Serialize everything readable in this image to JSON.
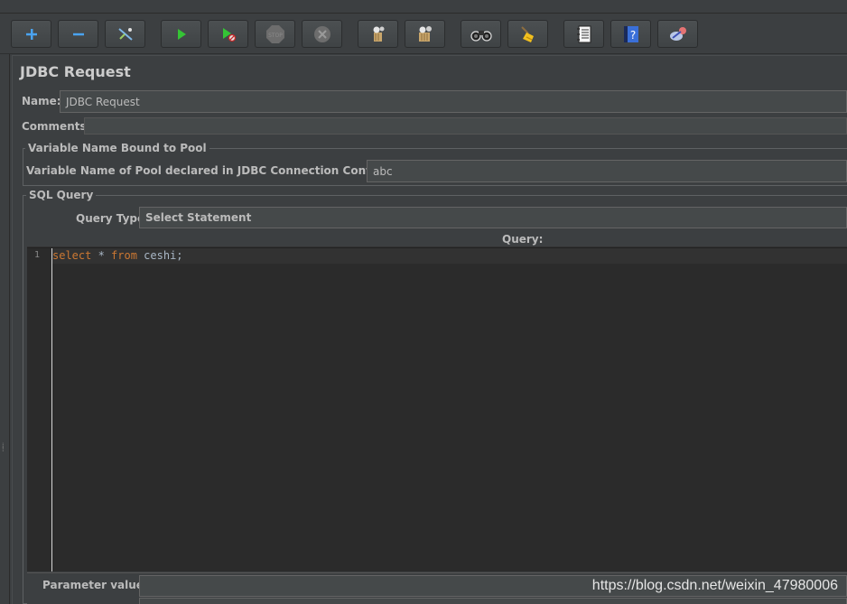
{
  "toolbar": {
    "buttons": [
      {
        "icon": "plus-icon"
      },
      {
        "icon": "minus-icon"
      },
      {
        "icon": "toggle-wand-icon"
      },
      {
        "icon": "start-icon"
      },
      {
        "icon": "start-no-pause-icon"
      },
      {
        "icon": "stop-icon"
      },
      {
        "icon": "shutdown-icon"
      },
      {
        "icon": "clear-icon"
      },
      {
        "icon": "clear-all-icon"
      },
      {
        "icon": "search-binoculars-icon"
      },
      {
        "icon": "reset-search-broom-icon"
      },
      {
        "icon": "function-helper-icon"
      },
      {
        "icon": "help-icon"
      },
      {
        "icon": "remote-start-icon"
      }
    ]
  },
  "panel": {
    "title": "JDBC Request",
    "name_label": "Name:",
    "name_value": "JDBC Request",
    "comments_label": "Comments:",
    "comments_value": ""
  },
  "pool_group": {
    "title": "Variable Name Bound to Pool",
    "pool_label": "Variable Name of Pool declared in JDBC Connection Configuration:",
    "pool_value": "abc"
  },
  "sql_group": {
    "title": "SQL Query",
    "query_type_label": "Query Type:",
    "query_type_value": "Select Statement",
    "query_label": "Query:",
    "line_number": "1",
    "code": {
      "kw1": "select",
      "mid": " * ",
      "kw2": "from",
      "rest": " ceshi;"
    },
    "param_values_label": "Parameter values:",
    "param_values_value": ""
  },
  "watermark": "https://blog.csdn.net/weixin_47980006",
  "colors": {
    "background": "#3c3f41",
    "editor_bg": "#2b2b2b",
    "keyword": "#cc7832"
  }
}
